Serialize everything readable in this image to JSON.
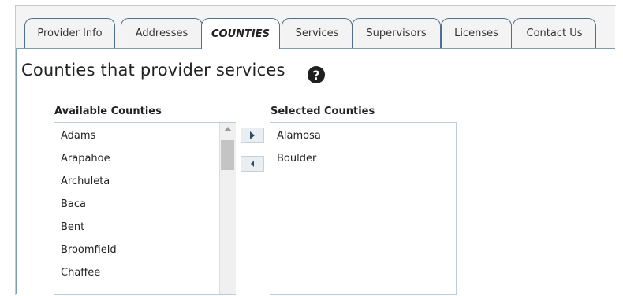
{
  "tabs": [
    {
      "label": "Provider Info",
      "active": false
    },
    {
      "label": "Addresses",
      "active": false
    },
    {
      "label": "COUNTIES",
      "active": true
    },
    {
      "label": "Services",
      "active": false
    },
    {
      "label": "Supervisors",
      "active": false
    },
    {
      "label": "Licenses",
      "active": false
    },
    {
      "label": "Contact Us",
      "active": false
    }
  ],
  "page": {
    "heading": "Counties that provider services",
    "help_glyph": "?"
  },
  "available": {
    "label": "Available Counties",
    "items": [
      "Adams",
      "Arapahoe",
      "Archuleta",
      "Baca",
      "Bent",
      "Broomfield",
      "Chaffee"
    ]
  },
  "selected": {
    "label": "Selected Counties",
    "items": [
      "Alamosa",
      "Boulder"
    ]
  },
  "colors": {
    "tab_border": "#4e6f8f",
    "listbox_border": "#b9cde0",
    "button_bg": "#e9eef3"
  },
  "icons": {
    "add": "triangle-right",
    "remove": "triangle-left",
    "help": "question-circle"
  }
}
